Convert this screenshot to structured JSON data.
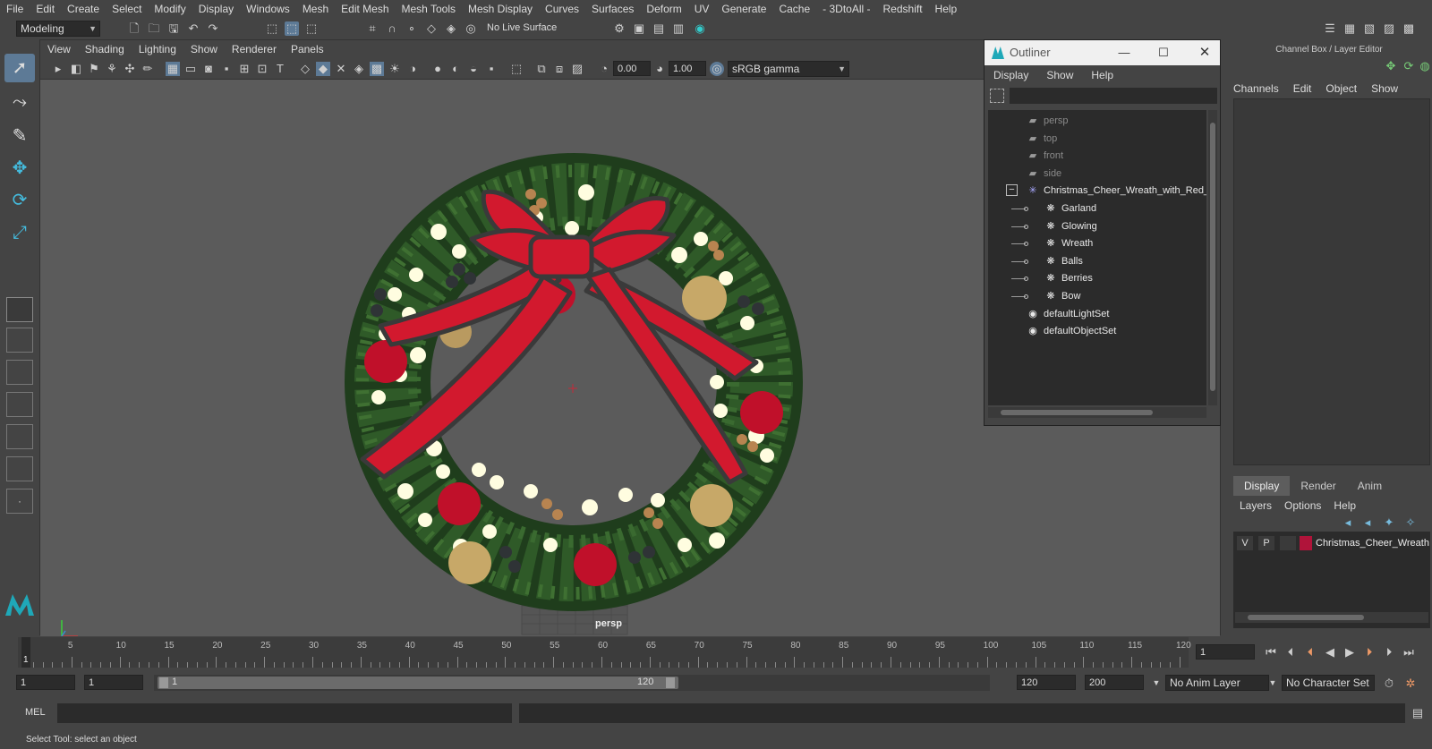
{
  "menubar": [
    "File",
    "Edit",
    "Create",
    "Select",
    "Modify",
    "Display",
    "Windows",
    "Mesh",
    "Edit Mesh",
    "Mesh Tools",
    "Mesh Display",
    "Curves",
    "Surfaces",
    "Deform",
    "UV",
    "Generate",
    "Cache",
    "- 3DtoAll -",
    "Redshift",
    "Help"
  ],
  "shelf": {
    "mode": "Modeling",
    "live_surface": "No Live Surface"
  },
  "viewport": {
    "menus": [
      "View",
      "Shading",
      "Lighting",
      "Show",
      "Renderer",
      "Panels"
    ],
    "exposure": "0.00",
    "gamma": "1.00",
    "color_space": "sRGB gamma",
    "camera_label": "persp"
  },
  "outliner": {
    "title": "Outliner",
    "menus": [
      "Display",
      "Show",
      "Help"
    ],
    "items": [
      {
        "label": "persp",
        "kind": "camera",
        "indent": 0
      },
      {
        "label": "top",
        "kind": "camera",
        "indent": 0
      },
      {
        "label": "front",
        "kind": "camera",
        "indent": 0
      },
      {
        "label": "side",
        "kind": "camera",
        "indent": 0
      },
      {
        "label": "Christmas_Cheer_Wreath_with_Red_",
        "kind": "group",
        "indent": 0
      },
      {
        "label": "Garland",
        "kind": "mesh",
        "indent": 1
      },
      {
        "label": "Glowing",
        "kind": "mesh",
        "indent": 1
      },
      {
        "label": "Wreath",
        "kind": "mesh",
        "indent": 1
      },
      {
        "label": "Balls",
        "kind": "mesh",
        "indent": 1
      },
      {
        "label": "Berries",
        "kind": "mesh",
        "indent": 1
      },
      {
        "label": "Bow",
        "kind": "mesh",
        "indent": 1
      },
      {
        "label": "defaultLightSet",
        "kind": "set",
        "indent": 0
      },
      {
        "label": "defaultObjectSet",
        "kind": "set",
        "indent": 0
      }
    ]
  },
  "channelbox": {
    "title": "Channel Box / Layer Editor",
    "menus": [
      "Channels",
      "Edit",
      "Object",
      "Show"
    ],
    "tabs": [
      "Display",
      "Render",
      "Anim"
    ],
    "layer_menus": [
      "Layers",
      "Options",
      "Help"
    ],
    "layer": {
      "v": "V",
      "p": "P",
      "name": "Christmas_Cheer_Wreath",
      "color": "#b0143a"
    }
  },
  "timeline": {
    "ticks": [
      "5",
      "10",
      "15",
      "20",
      "25",
      "30",
      "35",
      "40",
      "45",
      "50",
      "55",
      "60",
      "65",
      "70",
      "75",
      "80",
      "85",
      "90",
      "95",
      "100",
      "105",
      "110",
      "115",
      "120"
    ],
    "current_frame_marker": "1",
    "current_frame": "1"
  },
  "range": {
    "start": "1",
    "playback_start": "1",
    "slider_start": "1",
    "slider_end": "120",
    "playback_end": "120",
    "end": "200",
    "anim_layer": "No Anim Layer",
    "character_set": "No Character Set"
  },
  "cmdline": {
    "lang": "MEL"
  },
  "status": {
    "text": "Select Tool: select an object"
  }
}
